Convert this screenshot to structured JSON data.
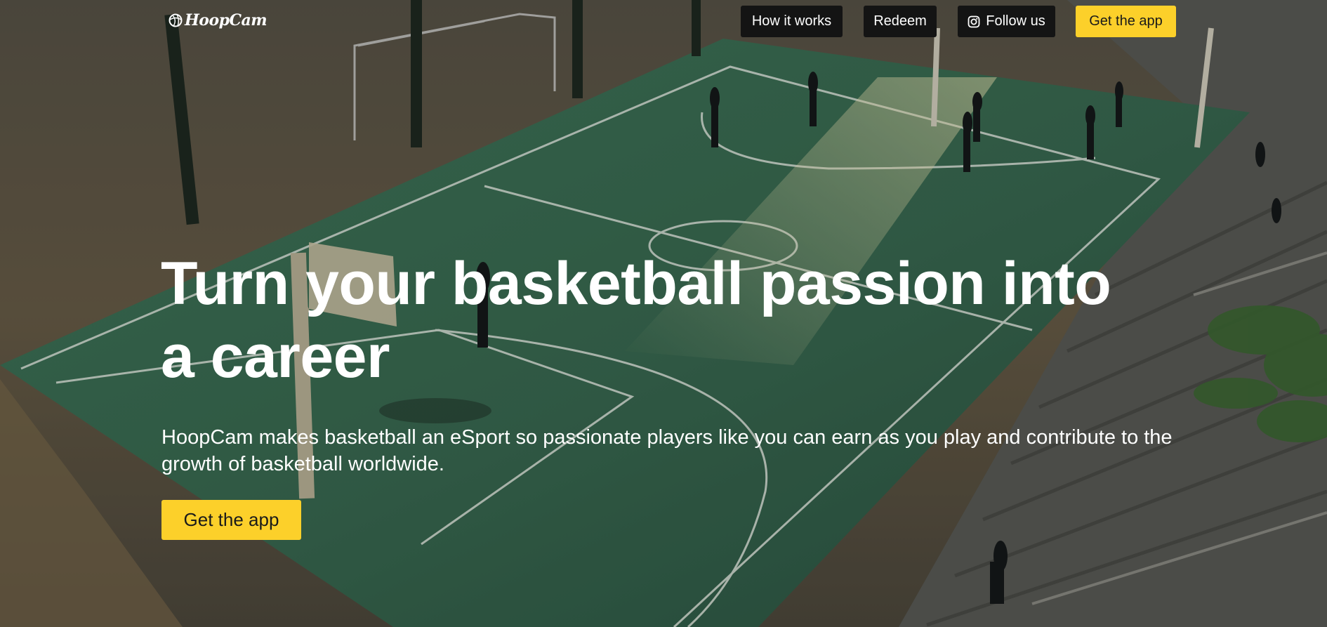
{
  "brand": {
    "name": "HoopCam",
    "icon": "basketball-icon"
  },
  "nav": {
    "how_it_works": "How it works",
    "redeem": "Redeem",
    "follow_us": "Follow us",
    "follow_icon": "instagram-icon",
    "get_app": "Get the app"
  },
  "hero": {
    "headline": "Turn your basketball passion into a career",
    "subtext": "HoopCam makes basketball an eSport so passionate players like you can earn as you play and contribute to the growth of basketball worldwide.",
    "cta": "Get the app",
    "image": "outdoor basketball court"
  },
  "colors": {
    "accent": "#fcd02a",
    "nav_button_bg": "#141414",
    "text": "#ffffff"
  }
}
